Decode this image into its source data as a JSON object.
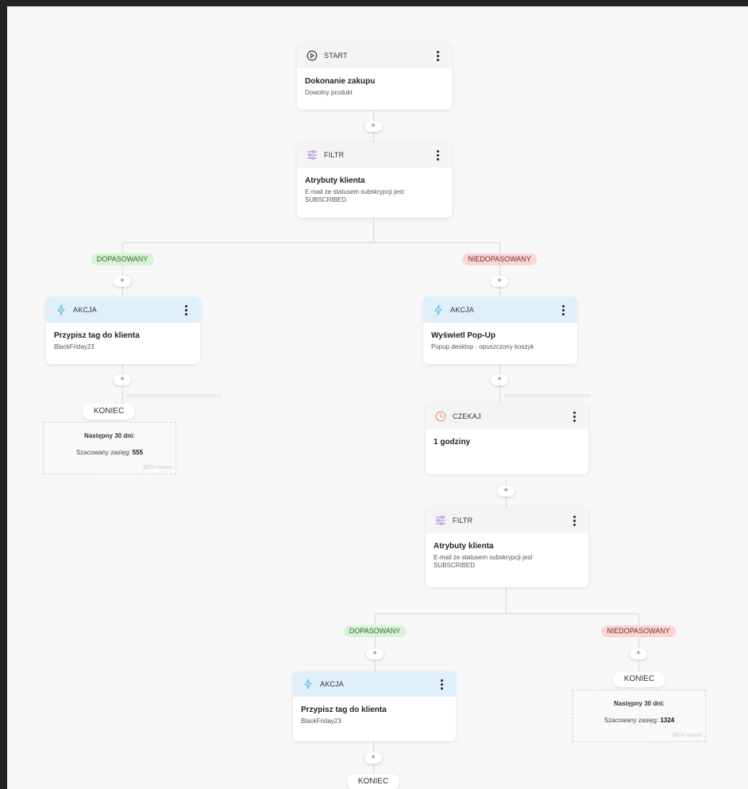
{
  "colors": {
    "akcja_header": "#dff0fa",
    "dopasowany": "#d8f3d6",
    "niedopasowany": "#f8d6d6",
    "wait_icon": "#f08a5d",
    "filter_icon": "#a37fd8",
    "action_icon": "#5ab0e6"
  },
  "nodes": {
    "start": {
      "type": "START",
      "icon": "play-circle-icon",
      "title": "Dokonanie zakupu",
      "desc": "Dowolny produkt"
    },
    "filter1": {
      "type": "FILTR",
      "icon": "sliders-icon",
      "title": "Atrybuty klienta",
      "desc": "E-mail ze statusem subskrypcji jest SUBSCRIBED"
    },
    "action_left": {
      "type": "AKCJA",
      "icon": "lightning-icon",
      "title": "Przypisz tag do klienta",
      "desc": "BlackFriday23"
    },
    "action_right": {
      "type": "AKCJA",
      "icon": "lightning-icon",
      "title": "Wyświetl Pop-Up",
      "desc": "Popup desktop - opuszczony koszyk"
    },
    "wait": {
      "type": "CZEKAJ",
      "icon": "clock-icon",
      "title": "1 godziny",
      "desc": ""
    },
    "filter2": {
      "type": "FILTR",
      "icon": "sliders-icon",
      "title": "Atrybuty klienta",
      "desc": "E-mail ze statusem subskrypcji jest SUBSCRIBED"
    },
    "action_bottom": {
      "type": "AKCJA",
      "icon": "lightning-icon",
      "title": "Przypisz tag do klienta",
      "desc": "BlackFriday23"
    }
  },
  "branches": {
    "match": "DOPASOWANY",
    "nomatch": "NIEDOPASOWANY"
  },
  "plus_label": "+",
  "end_label": "KONIEC",
  "reach_left": {
    "title": "Następny 30 dni:",
    "label": "Szacowany zasięg:",
    "value": "555",
    "beta": "BETA Version"
  },
  "reach_right": {
    "title": "Następny 30 dni:",
    "label": "Szacowany zasięg:",
    "value": "1324",
    "beta": "BETA Version"
  }
}
